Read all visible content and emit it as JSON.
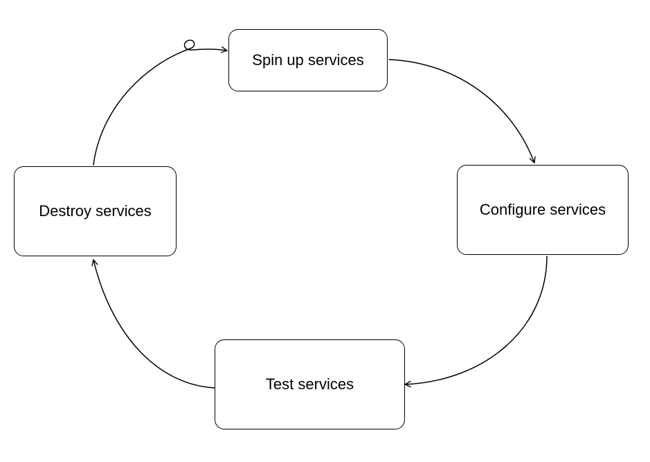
{
  "diagram": {
    "nodes": {
      "spin_up": {
        "label": "Spin up services"
      },
      "configure": {
        "label": "Configure services"
      },
      "test": {
        "label": "Test services"
      },
      "destroy": {
        "label": "Destroy services"
      }
    },
    "cycle_order": [
      "spin_up",
      "configure",
      "test",
      "destroy",
      "spin_up"
    ]
  }
}
